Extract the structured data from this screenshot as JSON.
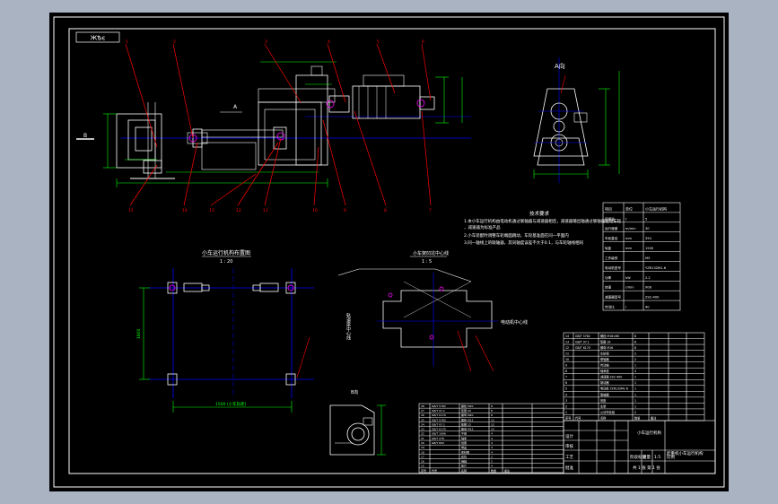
{
  "viewport": {
    "background": "#a9b3c1",
    "sheet_background": "#000000"
  },
  "colors": {
    "frame": "#ffffff",
    "part": "#ffffff",
    "dimension": "#00ff00",
    "centerline": "#0000ff",
    "leader": "#ff0000",
    "accent": "#ff00ff",
    "table": "#ffffff"
  },
  "top_left_stamp": "ЖѢͼ",
  "view_a_label": "A向",
  "view_b_label": "B向",
  "detail_label": "B",
  "section_a_label": "A",
  "bottom_left_view": {
    "title": "小车运行机构布置图",
    "scale": "1 : 20"
  },
  "right_view": {
    "title": "小车架凹坑中心线",
    "scale": "1 : 5"
  },
  "rail_center_label": "轨道梁中心线",
  "motor_center_label": "电动机中心线",
  "dim_span_label": "1500 (小车轨距)",
  "dim_base_label": "1800",
  "tech_requirements": {
    "heading": "技术要求",
    "lines": [
      "1.本小车运行机构由电动机通过联轴器与减速器相连，减速器输出轴通过联轴器驱动车轮",
      "  ，减速器为标准产品",
      "2.小车装配时调整车轮端面跳动，车轮基准面在同一平面内",
      "3.同一轴线上的联轴器，其同轴度误差不大于0.1，与车轮轴线相同"
    ]
  },
  "params_table": {
    "header": [
      "项目",
      "单位",
      "小车运行机构"
    ],
    "rows": [
      [
        "起重量",
        "t",
        "5"
      ],
      [
        "运行速度",
        "m/min",
        "30"
      ],
      [
        "车轮直径",
        "mm",
        "350"
      ],
      [
        "轨距",
        "mm",
        "1500"
      ],
      [
        "工作级别",
        "",
        "M5"
      ],
      [
        "电动机型号",
        "",
        "YZR132M1-6"
      ],
      [
        "功率",
        "kW",
        "2.2"
      ],
      [
        "转速",
        "r/min",
        "908"
      ],
      [
        "减速器型号",
        "",
        "ZSC-400"
      ],
      [
        "传动比",
        "i",
        "40"
      ]
    ]
  },
  "parts_list_right": {
    "rows": [
      [
        "14",
        "GB/T 5782",
        "螺栓 M16×60",
        "8",
        ""
      ],
      [
        "13",
        "GB/T 97.1",
        "垫圈 16",
        "8",
        ""
      ],
      [
        "12",
        "GB/T 6170",
        "螺母 M16",
        "8",
        ""
      ],
      [
        "11",
        "",
        "车轮组",
        "2",
        ""
      ],
      [
        "10",
        "",
        "联轴器",
        "2",
        ""
      ],
      [
        "9",
        "",
        "传动轴",
        "1",
        ""
      ],
      [
        "8",
        "",
        "轴承座",
        "4",
        ""
      ],
      [
        "7",
        "",
        "减速器 ZSC-400",
        "1",
        ""
      ],
      [
        "6",
        "",
        "制动器",
        "1",
        ""
      ],
      [
        "5",
        "",
        "电动机 YZR132M1-6",
        "1",
        ""
      ],
      [
        "4",
        "",
        "联轴器",
        "1",
        ""
      ],
      [
        "3",
        "",
        "底座",
        "1",
        ""
      ],
      [
        "2",
        "",
        "车架",
        "1",
        ""
      ],
      [
        "1",
        "",
        "从动车轮组",
        "2",
        ""
      ]
    ],
    "header": [
      "序号",
      "代号",
      "名称",
      "数量",
      "备注"
    ]
  },
  "parts_list_bottom": {
    "rows": [
      [
        "28",
        "GB/T 5782",
        "螺栓 M20",
        "8",
        ""
      ],
      [
        "27",
        "GB/T 97.1",
        "垫圈 20",
        "8",
        ""
      ],
      [
        "26",
        "GB/T 6170",
        "螺母 M20",
        "8",
        ""
      ],
      [
        "25",
        "GB/T 5783",
        "螺栓 M12",
        "12",
        ""
      ],
      [
        "24",
        "GB/T 97.1",
        "垫圈 12",
        "12",
        ""
      ],
      [
        "23",
        "GB/T 6170",
        "螺母 M12",
        "12",
        ""
      ],
      [
        "22",
        "GB/T 1096",
        "平键",
        "4",
        ""
      ],
      [
        "21",
        "GB/T 276",
        "轴承",
        "4",
        ""
      ],
      [
        "20",
        "GB/T 893",
        "挡圈",
        "4",
        ""
      ],
      [
        "19",
        "",
        "端盖",
        "4",
        ""
      ],
      [
        "18",
        "",
        "密封圈",
        "4",
        ""
      ],
      [
        "17",
        "",
        "套筒",
        "2",
        ""
      ],
      [
        "16",
        "",
        "销轴",
        "2",
        ""
      ],
      [
        "15",
        "",
        "垫片",
        "4",
        ""
      ]
    ],
    "header": [
      "序号",
      "代号",
      "名称",
      "数量",
      "备注"
    ]
  },
  "title_block": {
    "drawing_name": "小车运行机构",
    "school": "起重机小车运行机构",
    "scale": "1:5",
    "sheet": "共 1 张 第 1 张",
    "labels": [
      "设计",
      "审核",
      "工艺",
      "批准",
      "标记",
      "处数",
      "分区",
      "更改文件号",
      "签名",
      "年月日"
    ],
    "stage": [
      "阶段标记",
      "重量",
      "比例"
    ]
  }
}
